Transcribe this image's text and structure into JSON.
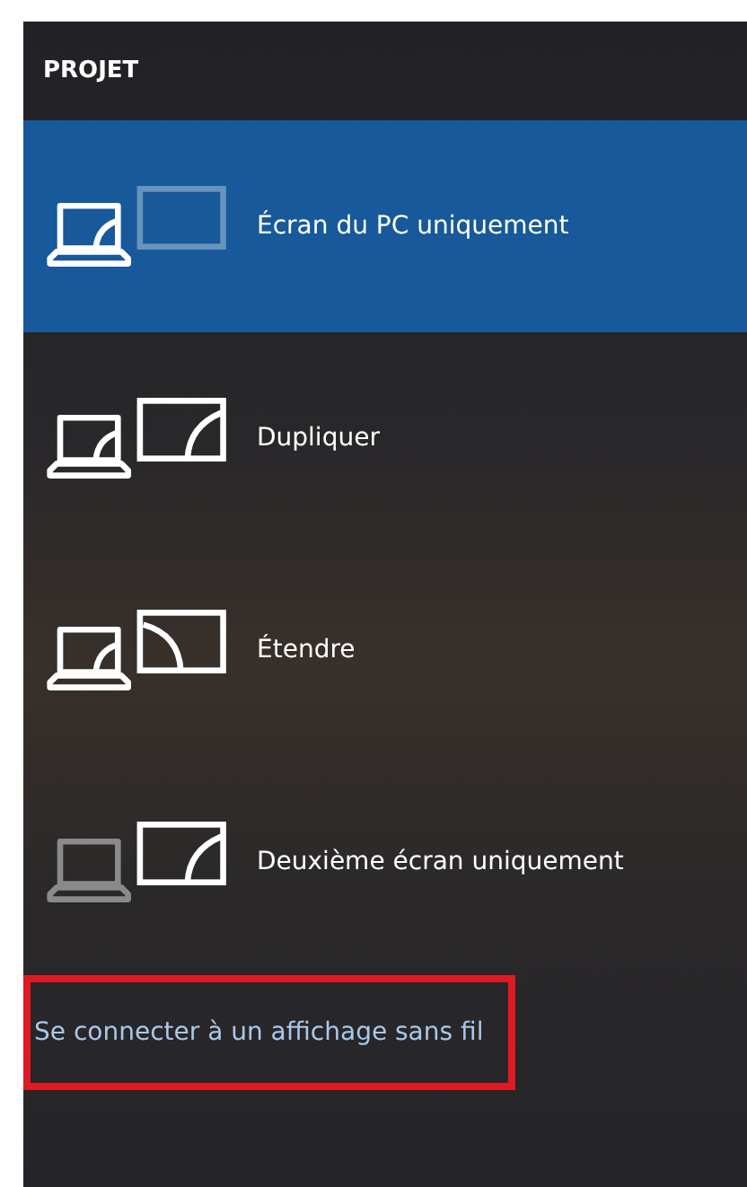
{
  "header": {
    "title": "PROJET"
  },
  "options": [
    {
      "kind": "pc-only",
      "label": "Écran du PC uniquement",
      "selected": true
    },
    {
      "kind": "duplicate",
      "label": "Dupliquer",
      "selected": false
    },
    {
      "kind": "extend",
      "label": "Étendre",
      "selected": false
    },
    {
      "kind": "second-only",
      "label": "Deuxième écran uniquement",
      "selected": false
    }
  ],
  "wireless_link": {
    "label": "Se connecter à un affichage sans fil",
    "highlighted": true
  }
}
